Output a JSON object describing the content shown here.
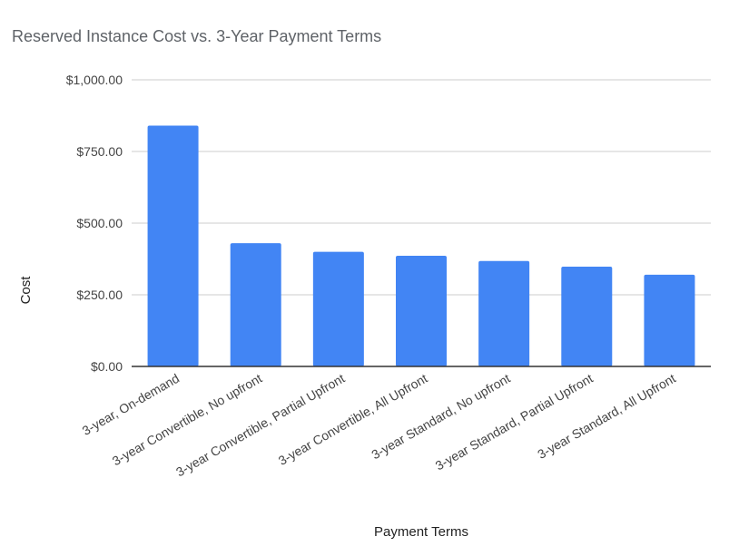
{
  "chart_data": {
    "type": "bar",
    "title": "Reserved Instance Cost vs. 3-Year Payment Terms",
    "xlabel": "Payment Terms",
    "ylabel": "Cost",
    "categories": [
      "3-year, On-demand",
      "3-year Convertible, No upfront",
      "3-year Convertible, Partial Upfront",
      "3-year Convertible, All Upfront",
      "3-year Standard, No upfront",
      "3-year Standard, Partial Upfront",
      "3-year Standard, All Upfront"
    ],
    "values": [
      840,
      430,
      400,
      386,
      368,
      348,
      320
    ],
    "ylim": [
      0,
      1000
    ],
    "yticks": [
      0,
      250,
      500,
      750,
      1000
    ],
    "ytick_labels": [
      "$0.00",
      "$250.00",
      "$500.00",
      "$750.00",
      "$1,000.00"
    ],
    "grid": true,
    "legend": "none",
    "colors": {
      "bar": "#4285f4",
      "grid": "#cccccc",
      "axis": "#333333",
      "title": "#5f6368",
      "text": "#444444"
    }
  }
}
